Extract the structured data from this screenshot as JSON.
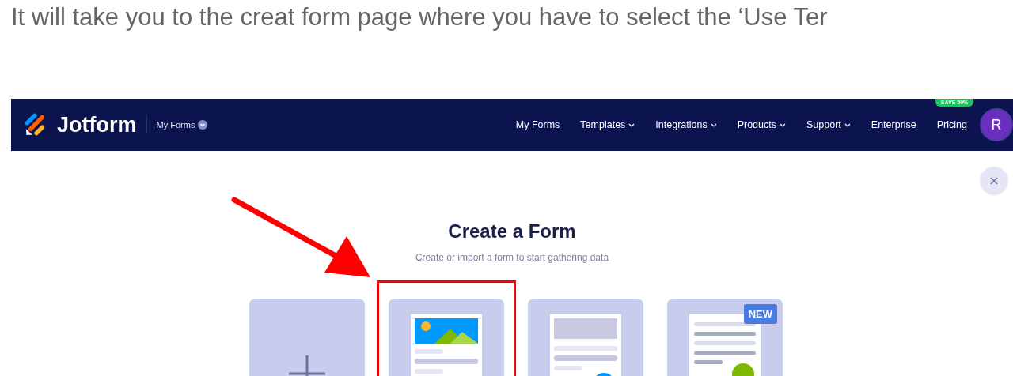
{
  "caption": "It will take you to the creat form page where you have to select the ‘Use Ter",
  "screenshot": {
    "navbar": {
      "logo": "Jotform",
      "workspace": "My Forms",
      "items": [
        {
          "label": "My Forms",
          "kind": "link"
        },
        {
          "label": "Templates",
          "kind": "menu"
        },
        {
          "label": "Integrations",
          "kind": "menu"
        },
        {
          "label": "Products",
          "kind": "menu"
        },
        {
          "label": "Support",
          "kind": "menu"
        },
        {
          "label": "Enterprise",
          "kind": "link"
        },
        {
          "label": "Pricing",
          "kind": "link",
          "badge": "SAVE 50%"
        }
      ],
      "avatar": "R"
    },
    "dialog": {
      "title": "Create a Form",
      "subtitle": "Create or import a form to start gathering data",
      "cards": [
        {
          "kind": "blank",
          "highlighted": false
        },
        {
          "kind": "template",
          "highlighted": true
        },
        {
          "kind": "import",
          "highlighted": false
        },
        {
          "kind": "document",
          "highlighted": false,
          "badge": "NEW"
        }
      ]
    }
  }
}
